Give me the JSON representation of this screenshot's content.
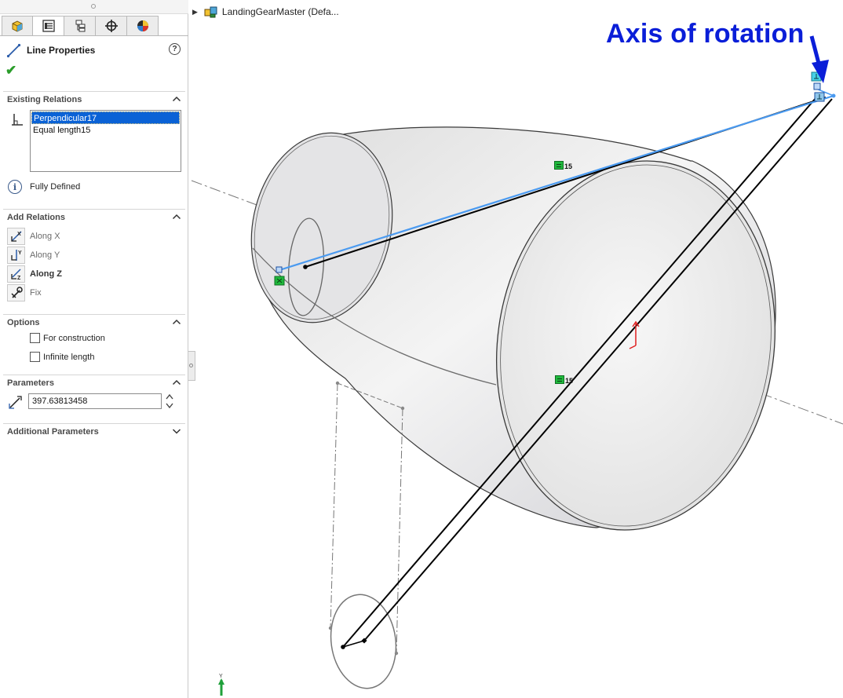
{
  "tabs": [
    {
      "name": "feature-manager",
      "icon": "feature-tree-icon"
    },
    {
      "name": "property-manager",
      "icon": "property-manager-icon",
      "active": true
    },
    {
      "name": "configuration-manager",
      "icon": "configuration-icon"
    },
    {
      "name": "dimxpert-manager",
      "icon": "dimxpert-icon"
    },
    {
      "name": "display-manager",
      "icon": "appearance-icon"
    }
  ],
  "property_manager": {
    "title": "Line Properties",
    "help_glyph": "?",
    "ok_glyph": "✔"
  },
  "existing_relations": {
    "heading": "Existing Relations",
    "items": [
      "Perpendicular17",
      "Equal length15"
    ],
    "selected_index": 0,
    "status_glyph": "i",
    "status": "Fully Defined"
  },
  "add_relations": {
    "heading": "Add Relations",
    "items": [
      {
        "label": "Along X",
        "icon": "along-x-icon",
        "emphasis": false
      },
      {
        "label": "Along Y",
        "icon": "along-y-icon",
        "emphasis": false
      },
      {
        "label": "Along Z",
        "icon": "along-z-icon",
        "emphasis": true
      },
      {
        "label": "Fix",
        "icon": "fix-icon",
        "emphasis": false
      }
    ]
  },
  "options": {
    "heading": "Options",
    "for_construction": {
      "label": "For construction",
      "checked": false
    },
    "infinite_length": {
      "label": "Infinite length",
      "checked": false
    }
  },
  "parameters": {
    "heading": "Parameters",
    "length_value": "397.63813458"
  },
  "additional_parameters": {
    "heading": "Additional Parameters"
  },
  "graphics": {
    "tree_expand_glyph": "▶",
    "model_name": "LandingGearMaster  (Defa...",
    "annotation": "Axis of rotation",
    "equal_tag_1": "15",
    "equal_tag_2": "15",
    "triad_label": "Y",
    "colors": {
      "annotation": "#0a1ed8",
      "selected_line": "#4a9af0",
      "sketch_line": "#000000",
      "relation_tag": "#1fb83c",
      "body_outline": "#3a3a3a"
    }
  }
}
